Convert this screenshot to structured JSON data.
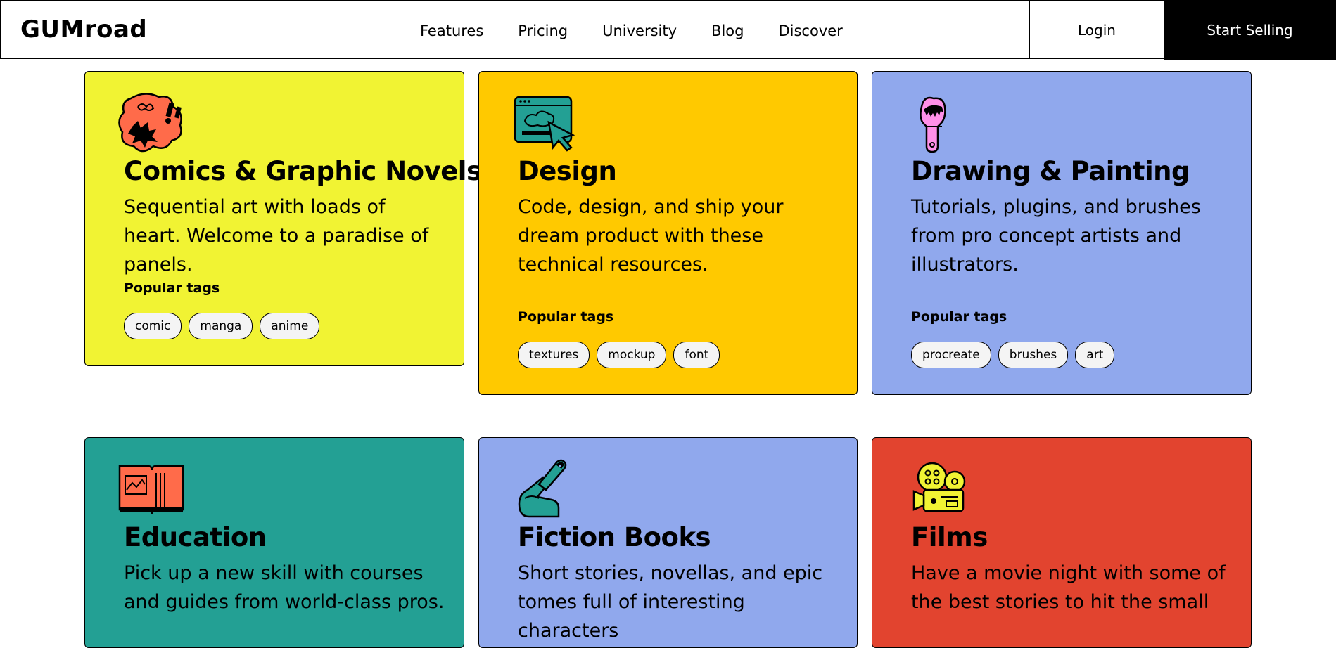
{
  "header": {
    "logo": "GUMroad",
    "nav": [
      "Features",
      "Pricing",
      "University",
      "Blog",
      "Discover"
    ],
    "login": "Login",
    "start_selling": "Start Selling"
  },
  "popular_tags_label": "Popular tags",
  "categories": [
    {
      "title": "Comics & Graphic Novels",
      "description": "Sequential art with loads of heart. Welcome to a paradise of panels.",
      "tags": [
        "comic",
        "manga",
        "anime"
      ],
      "color": "#f1f333",
      "icon": "comic-speech-bubble-icon"
    },
    {
      "title": "Design",
      "description": "Code, design, and ship your dream product with these technical resources.",
      "tags": [
        "textures",
        "mockup",
        "font"
      ],
      "color": "#ffc900",
      "icon": "design-window-cursor-icon"
    },
    {
      "title": "Drawing & Painting",
      "description": "Tutorials, plugins, and brushes from pro concept artists and illustrators.",
      "tags": [
        "procreate",
        "brushes",
        "art"
      ],
      "color": "#90a8ed",
      "icon": "paintbrush-icon"
    },
    {
      "title": "Education",
      "description": "Pick up a new skill with courses and guides from world-class pros.",
      "color": "#23a094",
      "icon": "open-book-icon"
    },
    {
      "title": "Fiction Books",
      "description": "Short stories, novellas, and epic tomes full of interesting characters",
      "color": "#90a8ed",
      "icon": "hand-writing-pen-icon"
    },
    {
      "title": "Films",
      "description": "Have a movie night with some of the best stories to hit the small",
      "color": "#e2442f",
      "icon": "film-projector-icon"
    }
  ]
}
